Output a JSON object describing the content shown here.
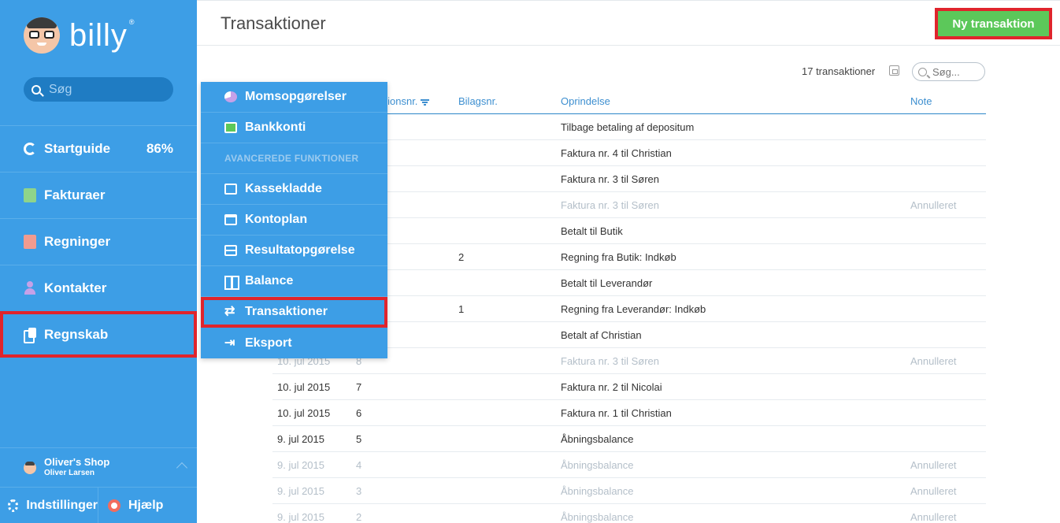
{
  "sidebar": {
    "brand": "billy",
    "search_placeholder": "Søg",
    "items": [
      {
        "label": "Startguide",
        "badge": "86%"
      },
      {
        "label": "Fakturaer"
      },
      {
        "label": "Regninger"
      },
      {
        "label": "Kontakter"
      },
      {
        "label": "Regnskab"
      }
    ],
    "shop_name": "Oliver's Shop",
    "user_name": "Oliver Larsen",
    "settings_label": "Indstillinger",
    "help_label": "Hjælp"
  },
  "header": {
    "title": "Transaktioner",
    "new_button": "Ny transaktion"
  },
  "toolbar": {
    "count": "17 transaktioner",
    "search_placeholder": "Søg..."
  },
  "table": {
    "headers": {
      "nr": "ktionsnr.",
      "bilag": "Bilagsnr.",
      "origin": "Oprindelse",
      "note": "Note"
    },
    "rows": [
      {
        "date": "",
        "nr": "",
        "bilag": "",
        "origin": "Tilbage betaling af depositum",
        "note": "",
        "muted": false
      },
      {
        "date": "",
        "nr": "",
        "bilag": "",
        "origin": "Faktura nr. 4 til Christian",
        "note": "",
        "muted": false
      },
      {
        "date": "",
        "nr": "",
        "bilag": "",
        "origin": "Faktura nr. 3 til Søren",
        "note": "",
        "muted": false
      },
      {
        "date": "",
        "nr": "",
        "bilag": "",
        "origin": "Faktura nr. 3 til Søren",
        "note": "Annulleret",
        "muted": true
      },
      {
        "date": "",
        "nr": "",
        "bilag": "",
        "origin": "Betalt til Butik",
        "note": "",
        "muted": false
      },
      {
        "date": "",
        "nr": "",
        "bilag": "2",
        "origin": "Regning fra Butik: Indkøb",
        "note": "",
        "muted": false
      },
      {
        "date": "",
        "nr": "",
        "bilag": "",
        "origin": "Betalt til Leverandør",
        "note": "",
        "muted": false
      },
      {
        "date": "",
        "nr": "",
        "bilag": "1",
        "origin": "Regning fra Leverandør: Indkøb",
        "note": "",
        "muted": false
      },
      {
        "date": "",
        "nr": "",
        "bilag": "",
        "origin": "Betalt af Christian",
        "note": "",
        "muted": false
      },
      {
        "date": "10. jul 2015",
        "nr": "8",
        "bilag": "",
        "origin": "Faktura nr. 3 til Søren",
        "note": "Annulleret",
        "muted": true
      },
      {
        "date": "10. jul 2015",
        "nr": "7",
        "bilag": "",
        "origin": "Faktura nr. 2 til Nicolai",
        "note": "",
        "muted": false
      },
      {
        "date": "10. jul 2015",
        "nr": "6",
        "bilag": "",
        "origin": "Faktura nr. 1 til Christian",
        "note": "",
        "muted": false
      },
      {
        "date": "9. jul 2015",
        "nr": "5",
        "bilag": "",
        "origin": "Åbningsbalance",
        "note": "",
        "muted": false
      },
      {
        "date": "9. jul 2015",
        "nr": "4",
        "bilag": "",
        "origin": "Åbningsbalance",
        "note": "Annulleret",
        "muted": true
      },
      {
        "date": "9. jul 2015",
        "nr": "3",
        "bilag": "",
        "origin": "Åbningsbalance",
        "note": "Annulleret",
        "muted": true
      },
      {
        "date": "9. jul 2015",
        "nr": "2",
        "bilag": "",
        "origin": "Åbningsbalance",
        "note": "Annulleret",
        "muted": true
      }
    ]
  },
  "dropdown": {
    "items": [
      {
        "label": "Momsopgørelser",
        "icon": "pie-chart-icon"
      },
      {
        "label": "Bankkonti",
        "icon": "bank-icon"
      },
      {
        "label": "AVANCEREDE FUNKTIONER",
        "icon": ""
      },
      {
        "label": "Kassekladde",
        "icon": "edit-icon"
      },
      {
        "label": "Kontoplan",
        "icon": "table-icon"
      },
      {
        "label": "Resultatopgørelse",
        "icon": "rows-icon"
      },
      {
        "label": "Balance",
        "icon": "columns-icon"
      },
      {
        "label": "Transaktioner",
        "icon": "transfer-icon"
      },
      {
        "label": "Eksport",
        "icon": "export-icon"
      }
    ]
  },
  "colors": {
    "sidebar": "#3d9ee6",
    "accent_green": "#5cc85a",
    "highlight_red": "#e0242c"
  }
}
